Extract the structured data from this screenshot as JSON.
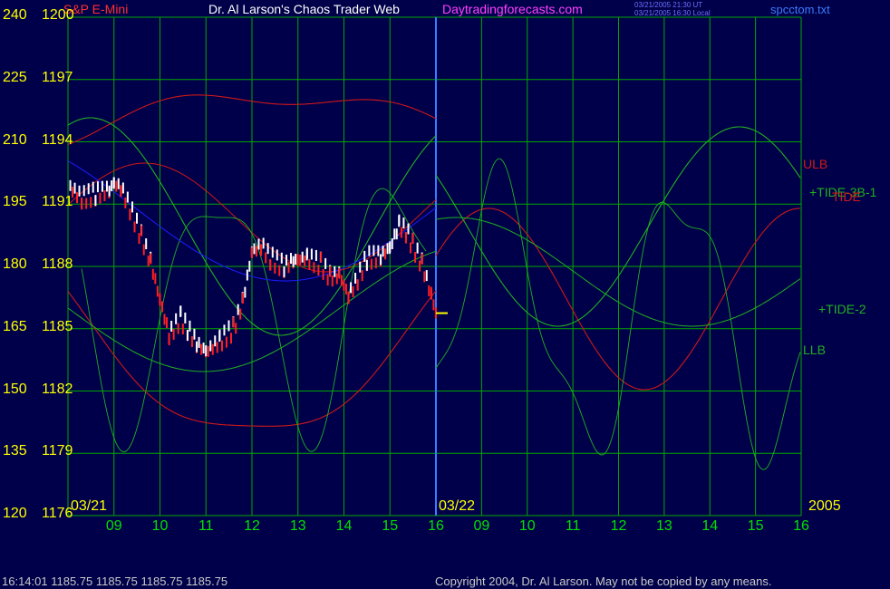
{
  "header": {
    "chart_name": "S&P E-Mini",
    "author": "Dr. Al Larson's Chaos Trader Web",
    "site": "Daytradingforecasts.com",
    "time_ut": "03/21/2005 21:30 UT",
    "time_local": "03/21/2005 16:30 Local",
    "file": "spcctom.txt"
  },
  "footer": {
    "quote": "16:14:01  1185.75 1185.75 1185.75 1185.75",
    "copyright": "Copyright 2004, Dr. Al Larson. May not be copied by any means."
  },
  "colors": {
    "background": "#00004a",
    "grid": "#00a800",
    "price_up": "#ffffff",
    "price_down": "#ff2020",
    "band_red": "#d01818",
    "tide_green": "#20b020",
    "ma_blue": "#1c1cff",
    "yellow": "#ffff00",
    "cyan_label": "#3a7bff"
  },
  "chart_data": {
    "type": "line",
    "title": "S&P E-Mini",
    "left_axis_ticks": [
      "240",
      "225",
      "210",
      "195",
      "180",
      "165",
      "150",
      "135",
      "120"
    ],
    "right_axis_ticks": [
      "1200",
      "1197",
      "1194",
      "1191",
      "1188",
      "1185",
      "1182",
      "1179",
      "1176"
    ],
    "ylim": [
      1176,
      1200
    ],
    "x_tick_labels": [
      "09",
      "10",
      "11",
      "12",
      "13",
      "14",
      "15",
      "16",
      "09",
      "10",
      "11",
      "12",
      "13",
      "14",
      "15",
      "16"
    ],
    "date_labels": [
      "03/21",
      "03/22",
      "2005"
    ],
    "series_labels": [
      "ULB",
      "+TIDE-3B-1",
      "TIDE",
      "+TIDE-2",
      "LLB"
    ],
    "last_price": 1185.75,
    "price_path": [
      [
        8.05,
        1191.8
      ],
      [
        8.3,
        1191.3
      ],
      [
        8.6,
        1191.5
      ],
      [
        8.9,
        1191.7
      ],
      [
        9.0,
        1192.0
      ],
      [
        9.15,
        1191.8
      ],
      [
        9.35,
        1190.8
      ],
      [
        9.6,
        1189.4
      ],
      [
        9.8,
        1188.2
      ],
      [
        10.0,
        1186.4
      ],
      [
        10.2,
        1184.7
      ],
      [
        10.45,
        1185.5
      ],
      [
        10.6,
        1185.0
      ],
      [
        10.8,
        1184.3
      ],
      [
        11.0,
        1183.9
      ],
      [
        11.3,
        1184.4
      ],
      [
        11.6,
        1185.0
      ],
      [
        11.8,
        1186.3
      ],
      [
        12.0,
        1188.7
      ],
      [
        12.2,
        1189.0
      ],
      [
        12.4,
        1188.4
      ],
      [
        12.7,
        1188.0
      ],
      [
        12.9,
        1188.3
      ],
      [
        13.2,
        1188.4
      ],
      [
        13.5,
        1188.1
      ],
      [
        13.7,
        1187.5
      ],
      [
        13.9,
        1187.6
      ],
      [
        14.1,
        1186.6
      ],
      [
        14.3,
        1187.4
      ],
      [
        14.5,
        1188.4
      ],
      [
        14.8,
        1188.5
      ],
      [
        15.0,
        1188.9
      ],
      [
        15.2,
        1190.0
      ],
      [
        15.35,
        1189.7
      ],
      [
        15.5,
        1189.0
      ],
      [
        15.7,
        1188.1
      ],
      [
        15.9,
        1186.6
      ],
      [
        16.0,
        1185.75
      ]
    ]
  }
}
